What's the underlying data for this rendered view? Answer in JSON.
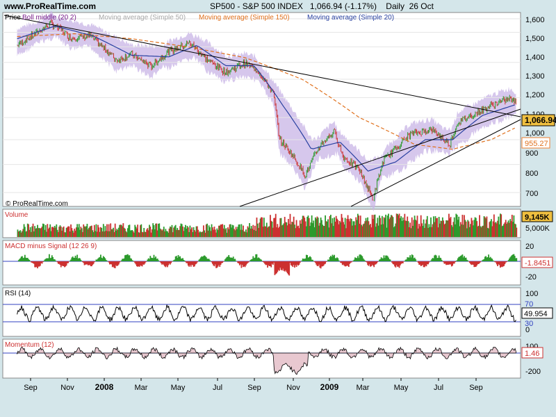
{
  "header": {
    "site": "www.ProRealTime.com",
    "title": "SP500 - S&P 500 INDEX",
    "quote": "1,066.94 (-1.17%)",
    "period": "Daily",
    "date": "26 Oct"
  },
  "price_panel": {
    "legend": [
      {
        "text": "Price",
        "color": "#000000"
      },
      {
        "text": "Boll middle (20 2)",
        "color": "#7a1f8a"
      },
      {
        "text": "Moving average (Simple 50)",
        "color": "#a8a8a8"
      },
      {
        "text": "Moving average (Simple 150)",
        "color": "#e0701c"
      },
      {
        "text": "Moving average (Simple 20)",
        "color": "#2840a0"
      }
    ],
    "yticks": [
      "1,600",
      "1,500",
      "1,400",
      "1,300",
      "1,200",
      "1,100",
      "1,000",
      "900",
      "800",
      "700"
    ],
    "last_price_tag": "1,066.94",
    "ma150_tag": "955.27",
    "watermark": "© ProRealTime.com"
  },
  "volume_panel": {
    "label": "Volume",
    "tag": "9,145K",
    "ytick": "5,000K"
  },
  "macd_panel": {
    "label": "MACD minus Signal (12 26 9)",
    "tag": "-1.8451",
    "yticks": [
      "20",
      "-20"
    ]
  },
  "rsi_panel": {
    "label": "RSI (14)",
    "tags": [
      "70",
      "49.954",
      "30"
    ],
    "yticks": [
      "100",
      "0"
    ]
  },
  "momentum_panel": {
    "label": "Momentum (12)",
    "tag": "1.46",
    "yticks": [
      "100",
      "-200"
    ]
  },
  "x_axis": {
    "labels": [
      "Sep",
      "Nov",
      "2008",
      "Mar",
      "May",
      "Jul",
      "Sep",
      "Nov",
      "2009",
      "Mar",
      "May",
      "Jul",
      "Sep"
    ],
    "bold": [
      "2008",
      "2009"
    ]
  },
  "colors": {
    "background": "#d4e6ea",
    "plot_bg": "#ffffff",
    "bollinger_band": "#c8b4e6",
    "up_bar": "#2c9a2c",
    "down_bar": "#cc3030",
    "tag_gold": "#f0c040",
    "tag_orange": "#f08030"
  },
  "chart_data": {
    "type": "line",
    "title": "SP500 - S&P 500 INDEX",
    "ylim": [
      650,
      1650
    ],
    "yticks": [
      1600,
      1500,
      1400,
      1300,
      1200,
      1100,
      1000,
      900,
      800,
      700
    ],
    "series": [
      {
        "name": "Price",
        "x": [
          "2007-08-15",
          "2007-09-10",
          "2007-10-09",
          "2007-11-10",
          "2007-12-10",
          "2008-01-22",
          "2008-02-15",
          "2008-03-17",
          "2008-04-15",
          "2008-05-19",
          "2008-06-15",
          "2008-07-15",
          "2008-08-15",
          "2008-09-05",
          "2008-09-30",
          "2008-10-10",
          "2008-10-27",
          "2008-11-20",
          "2008-12-15",
          "2009-01-06",
          "2009-01-20",
          "2009-02-15",
          "2009-03-09",
          "2009-03-26",
          "2009-04-15",
          "2009-05-08",
          "2009-06-12",
          "2009-07-10",
          "2009-07-24",
          "2009-08-15",
          "2009-09-15",
          "2009-10-16",
          "2009-10-26"
        ],
        "values": [
          1410,
          1480,
          1565,
          1460,
          1475,
          1315,
          1350,
          1275,
          1370,
          1425,
          1320,
          1240,
          1295,
          1250,
          1120,
          900,
          850,
          760,
          880,
          935,
          830,
          780,
          677,
          815,
          865,
          925,
          945,
          880,
          980,
          1010,
          1060,
          1095,
          1067
        ]
      },
      {
        "name": "Moving average (Simple 20)",
        "x": [
          "2007-08-15",
          "2007-10-15",
          "2007-12-15",
          "2008-02-15",
          "2008-04-15",
          "2008-05-30",
          "2008-07-15",
          "2008-08-30",
          "2008-10-15",
          "2008-11-30",
          "2009-01-15",
          "2009-03-01",
          "2009-04-15",
          "2009-06-01",
          "2009-07-15",
          "2009-09-01",
          "2009-10-26"
        ],
        "values": [
          1455,
          1545,
          1475,
          1345,
          1335,
          1410,
          1280,
          1280,
          1060,
          860,
          890,
          775,
          810,
          900,
          900,
          1010,
          1065
        ]
      },
      {
        "name": "Moving average (Simple 150)",
        "x": [
          "2007-08-15",
          "2007-11-15",
          "2008-02-15",
          "2008-05-15",
          "2008-08-15",
          "2008-11-15",
          "2009-02-15",
          "2009-05-15",
          "2009-07-15",
          "2009-09-15",
          "2009-10-26"
        ],
        "values": [
          1470,
          1490,
          1455,
          1400,
          1330,
          1200,
          1000,
          880,
          860,
          900,
          955
        ]
      }
    ],
    "x_axis_labels": [
      "Sep",
      "Nov",
      "2008",
      "Mar",
      "May",
      "Jul",
      "Sep",
      "Nov",
      "2009",
      "Mar",
      "May",
      "Jul",
      "Sep"
    ]
  }
}
